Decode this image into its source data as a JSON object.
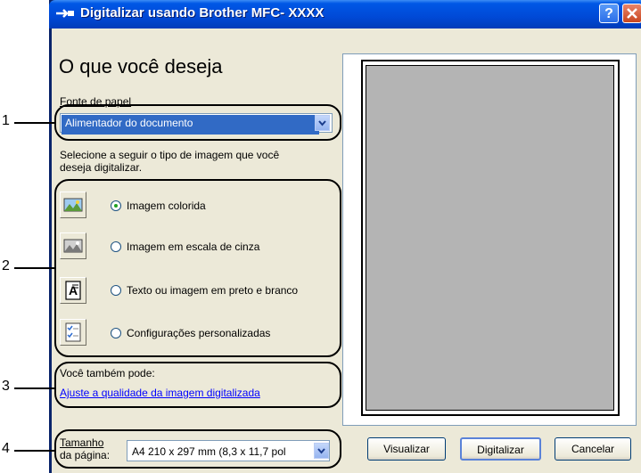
{
  "window": {
    "title": "Digitalizar usando Brother MFC- XXXX",
    "help_label": "?"
  },
  "main": {
    "heading": "O que você deseja",
    "paper_source": {
      "label": "Fonte de papel",
      "selected": "Alimentador do documento"
    },
    "image_type_prompt_line1": "Selecione a seguir o tipo de imagem que você",
    "image_type_prompt_line2": "deseja digitalizar.",
    "image_types": [
      {
        "label": "Imagem colorida",
        "selected": true
      },
      {
        "label": "Imagem em escala de cinza",
        "selected": false
      },
      {
        "label": "Texto ou imagem em preto e branco",
        "selected": false
      },
      {
        "label": "Configurações personalizadas",
        "selected": false
      }
    ],
    "also_label": "Você também pode:",
    "adjust_link": "Ajuste a qualidade da imagem digitalizada",
    "page_size": {
      "label_line1": "Tamanho",
      "label_line2": "da página:",
      "selected": "A4 210 x 297 mm (8,3 x 11,7 pol"
    }
  },
  "buttons": {
    "preview": "Visualizar",
    "scan": "Digitalizar",
    "cancel": "Cancelar"
  },
  "callouts": [
    "1",
    "2",
    "3",
    "4"
  ],
  "icons": {
    "title": "scanner-arrow-icon",
    "color_image": "color-photo-icon",
    "gray_image": "grayscale-photo-icon",
    "bw_text": "text-document-icon",
    "custom": "custom-settings-icon"
  },
  "colors": {
    "title_bar": "#0054e3",
    "selection": "#316ac5",
    "dialog_bg": "#ece9d8",
    "link": "#0000ff",
    "preview_area": "#b4b4b4"
  }
}
